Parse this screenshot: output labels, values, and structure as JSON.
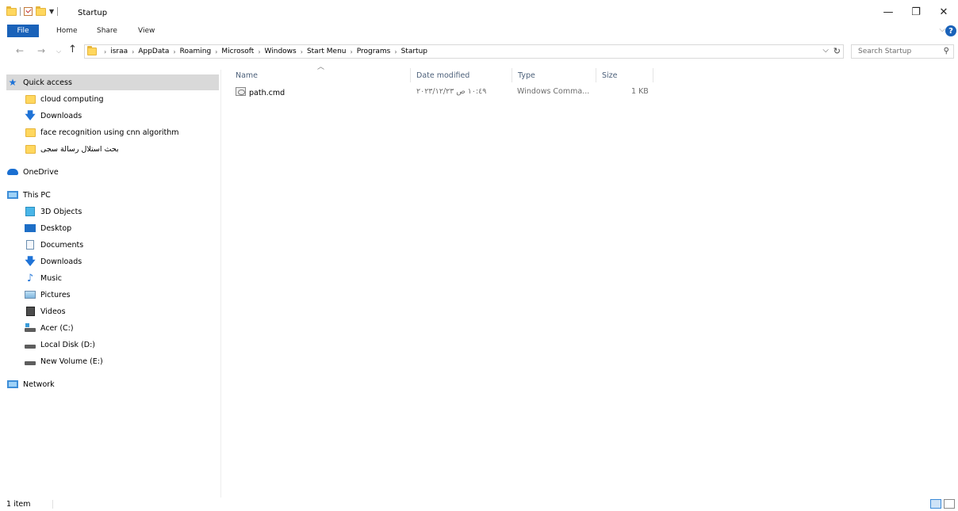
{
  "window": {
    "title": "Startup",
    "minimize_glyph": "—",
    "restore_glyph": "❐",
    "close_glyph": "✕"
  },
  "ribbon": {
    "file": "File",
    "tabs": [
      "Home",
      "Share",
      "View"
    ],
    "help_glyph": "?"
  },
  "address": {
    "breadcrumbs": [
      "israa",
      "AppData",
      "Roaming",
      "Microsoft",
      "Windows",
      "Start Menu",
      "Programs",
      "Startup"
    ],
    "search_placeholder": "Search Startup"
  },
  "nav": {
    "quick_access": "Quick access",
    "pinned": [
      "cloud computing",
      "Downloads",
      "face recognition using cnn algorithm",
      "بحث استلال رسالة سجى"
    ],
    "onedrive": "OneDrive",
    "this_pc": "This PC",
    "pc_items": [
      "3D Objects",
      "Desktop",
      "Documents",
      "Downloads",
      "Music",
      "Pictures",
      "Videos",
      "Acer (C:)",
      "Local Disk (D:)",
      "New Volume (E:)"
    ],
    "network": "Network"
  },
  "columns": {
    "name": "Name",
    "date": "Date modified",
    "type": "Type",
    "size": "Size"
  },
  "files": [
    {
      "name": "path.cmd",
      "date": "١٠:٤٩ ص ٢٠٢٣/١٢/٢٣",
      "type": "Windows Comma...",
      "size": "1 KB"
    }
  ],
  "status": {
    "count": "1 item"
  },
  "colors": {
    "accent": "#1a62b9",
    "folder": "#ffd75e",
    "selection": "#d9d9d9"
  }
}
